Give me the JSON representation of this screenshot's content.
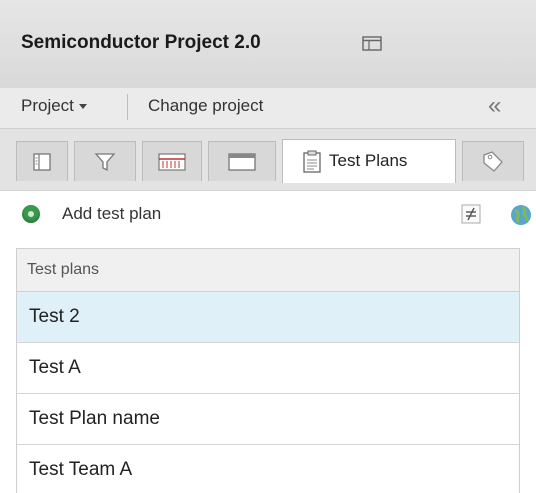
{
  "header": {
    "title": "Semiconductor Project 2.0",
    "layout_icon": "window-layout-icon"
  },
  "projbar": {
    "project_menu_label": "Project",
    "change_project_label": "Change project",
    "collapse_icon": "double-chevron-left-icon",
    "collapse_glyph": "«"
  },
  "tabs": [
    {
      "icon": "list-panel-icon",
      "label": "",
      "active": false
    },
    {
      "icon": "filter-icon",
      "label": "",
      "active": false
    },
    {
      "icon": "timeline-icon",
      "label": "",
      "active": false
    },
    {
      "icon": "window-icon",
      "label": "",
      "active": false
    },
    {
      "icon": "clipboard-icon",
      "label": "Test Plans",
      "active": true
    },
    {
      "icon": "tag-icon",
      "label": "",
      "active": false
    }
  ],
  "toolbar": {
    "add_label": "Add test plan",
    "add_icon": "add-circle-icon",
    "right_icons": [
      "not-equal-icon",
      "globe-icon"
    ]
  },
  "table": {
    "header": "Test plans",
    "rows": [
      "Test 2",
      "Test A",
      "Test Plan name",
      "Test Team A"
    ],
    "selected_index": 0
  },
  "colors": {
    "selected_row": "#dff0f8",
    "add_green": "#3a9a4a"
  }
}
